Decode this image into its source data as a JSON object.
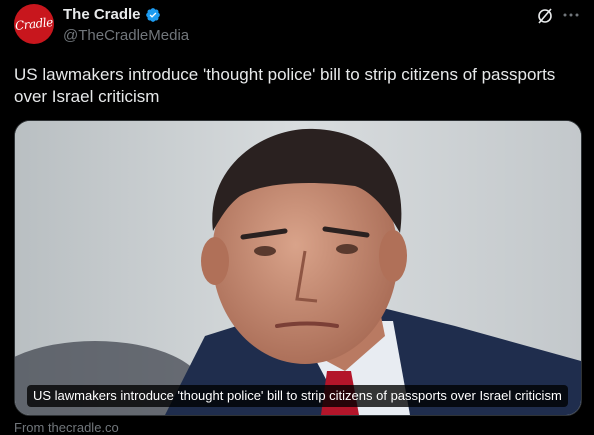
{
  "author": {
    "display_name": "The Cradle",
    "handle": "@TheCradleMedia",
    "avatar_text": "Cradle",
    "verified": true
  },
  "post": {
    "text": "US lawmakers introduce 'thought police' bill to strip citizens of passports over Israel criticism"
  },
  "card": {
    "caption": "US lawmakers introduce 'thought police' bill to strip citizens of passports over Israel criticism",
    "source": "From thecradle.co"
  },
  "icons": {
    "verified": "verified-badge-icon",
    "grok": "grok-icon",
    "more": "more-icon"
  },
  "colors": {
    "background": "#000000",
    "text_primary": "#e7e9ea",
    "text_secondary": "#71767b",
    "verified_blue": "#1d9bf0",
    "avatar_red": "#c8161d"
  }
}
